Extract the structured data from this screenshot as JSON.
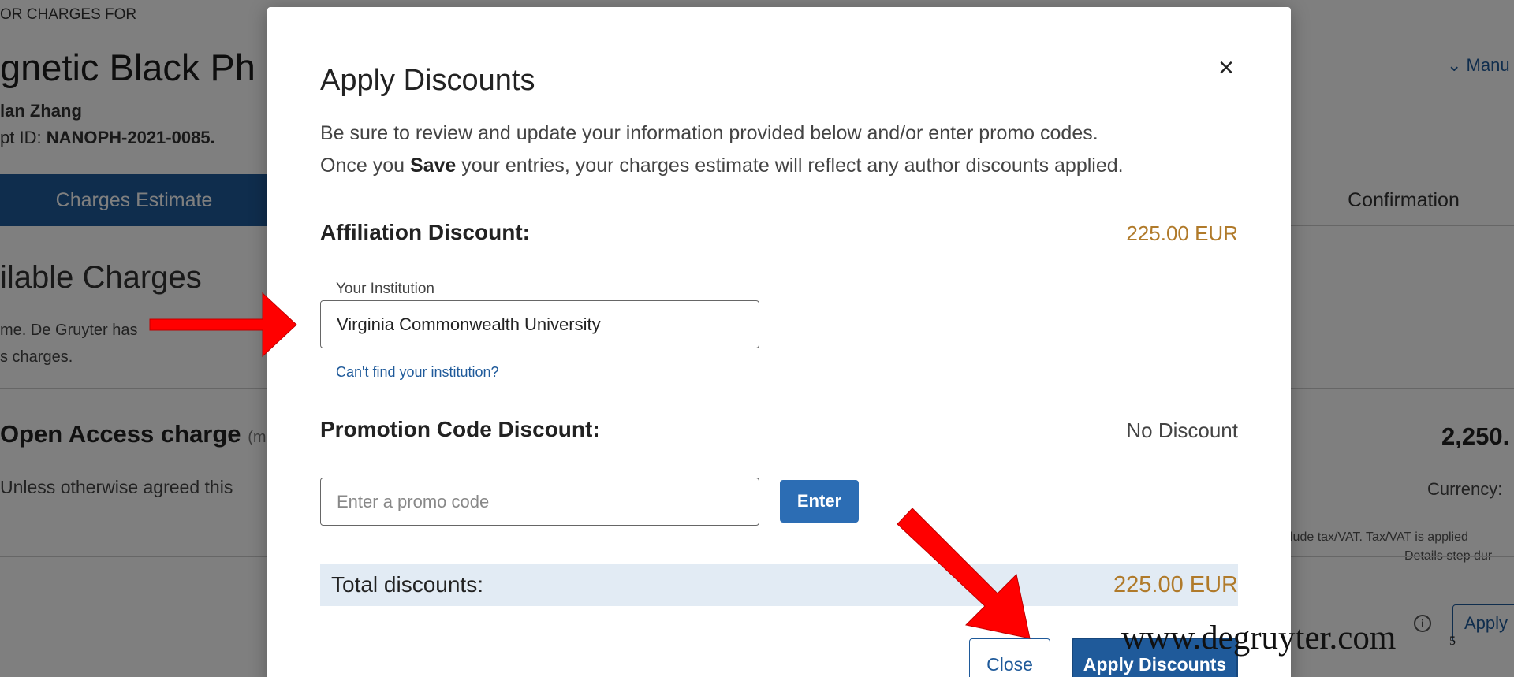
{
  "background": {
    "eyebrow": "OR CHARGES FOR",
    "article_title": "gnetic Black Ph",
    "author": "lan Zhang",
    "manuscript_label": "pt ID: ",
    "manuscript_id": "NANOPH-2021-0085.",
    "manu_link": "⌄ Manu",
    "step_active": "Charges Estimate",
    "step_confirmation": "Confirmation",
    "section_title": "ilable Charges",
    "section_desc_line1": "me. De Gruyter has",
    "section_desc_line2": "s charges.",
    "charge_name": "Open Access charge",
    "charge_hint": "(m",
    "charge_desc": "Unless otherwise agreed this",
    "charge_amount": "2,250.",
    "currency": "Currency:",
    "tax_note_line1": "lude tax/VAT. Tax/VAT is applied",
    "tax_note_line2": "Details step dur",
    "info_icon": "info-icon",
    "apply_button": "Apply"
  },
  "modal": {
    "close_symbol": "×",
    "title": "Apply Discounts",
    "intro_line1": "Be sure to review and update your information provided below and/or enter promo codes.",
    "intro_line2_pre": "Once you ",
    "intro_line2_bold": "Save",
    "intro_line2_post": " your entries, your charges estimate will reflect any author discounts applied.",
    "affiliation_label": "Affiliation Discount:",
    "affiliation_value": "225.00 EUR",
    "institution_label": "Your Institution",
    "institution_value": "Virginia Commonwealth University",
    "cant_find_link": "Can't find your institution?",
    "promo_label": "Promotion Code Discount:",
    "promo_value": "No Discount",
    "promo_placeholder": "Enter a promo code",
    "enter_button": "Enter",
    "total_label": "Total discounts:",
    "total_value": "225.00 EUR",
    "close_button": "Close",
    "apply_discounts_button": "Apply Discounts"
  },
  "annotations": {
    "footer_url": "www.degruyter.com",
    "slide_number": "5",
    "arrow_color": "#ff0000"
  },
  "colors": {
    "brand_blue": "#1f5a9a",
    "discount_amber": "#b07a2a",
    "total_bg": "#e2ebf4"
  }
}
